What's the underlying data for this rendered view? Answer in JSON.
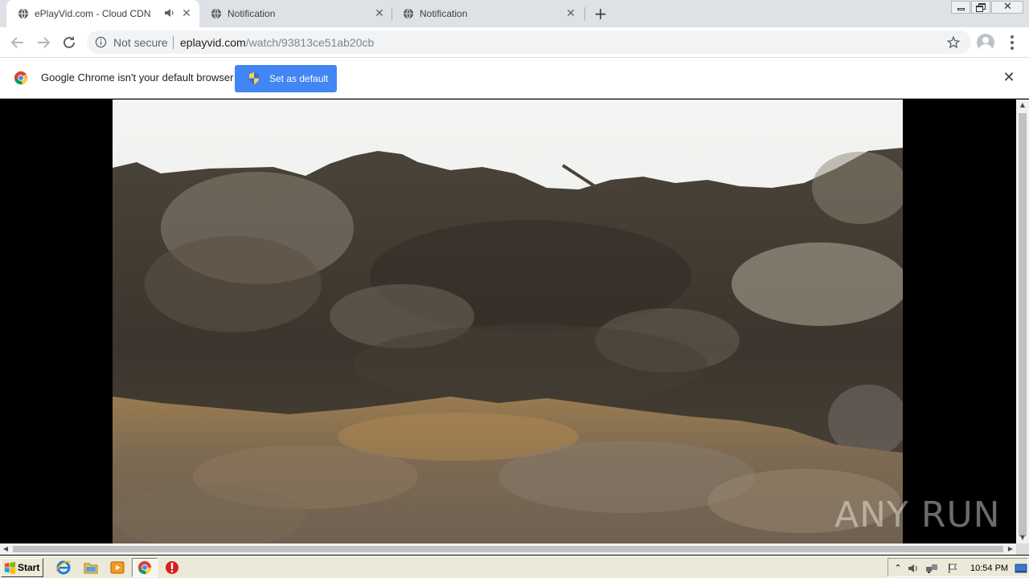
{
  "tabs": [
    {
      "title": "ePlayVid.com - Cloud CDN",
      "active": true,
      "audio": true
    },
    {
      "title": "Notification",
      "active": false
    },
    {
      "title": "Notification",
      "active": false
    }
  ],
  "toolbar": {
    "security_label": "Not secure",
    "url_host": "eplayvid.com",
    "url_path": "/watch/93813ce51ab20cb"
  },
  "infobar": {
    "message": "Google Chrome isn't your default browser",
    "button_label": "Set as default"
  },
  "watermark": {
    "text": "ANY RUN"
  },
  "taskbar": {
    "start_label": "Start",
    "clock": "10:54 PM",
    "quick_launch": [
      "internet-explorer-icon",
      "folder-icon",
      "media-player-icon",
      "chrome-icon",
      "stop-icon"
    ]
  },
  "colors": {
    "chrome_tabstrip": "#dee1e6",
    "accent_blue": "#4285f4",
    "taskbar": "#ece9d8"
  }
}
